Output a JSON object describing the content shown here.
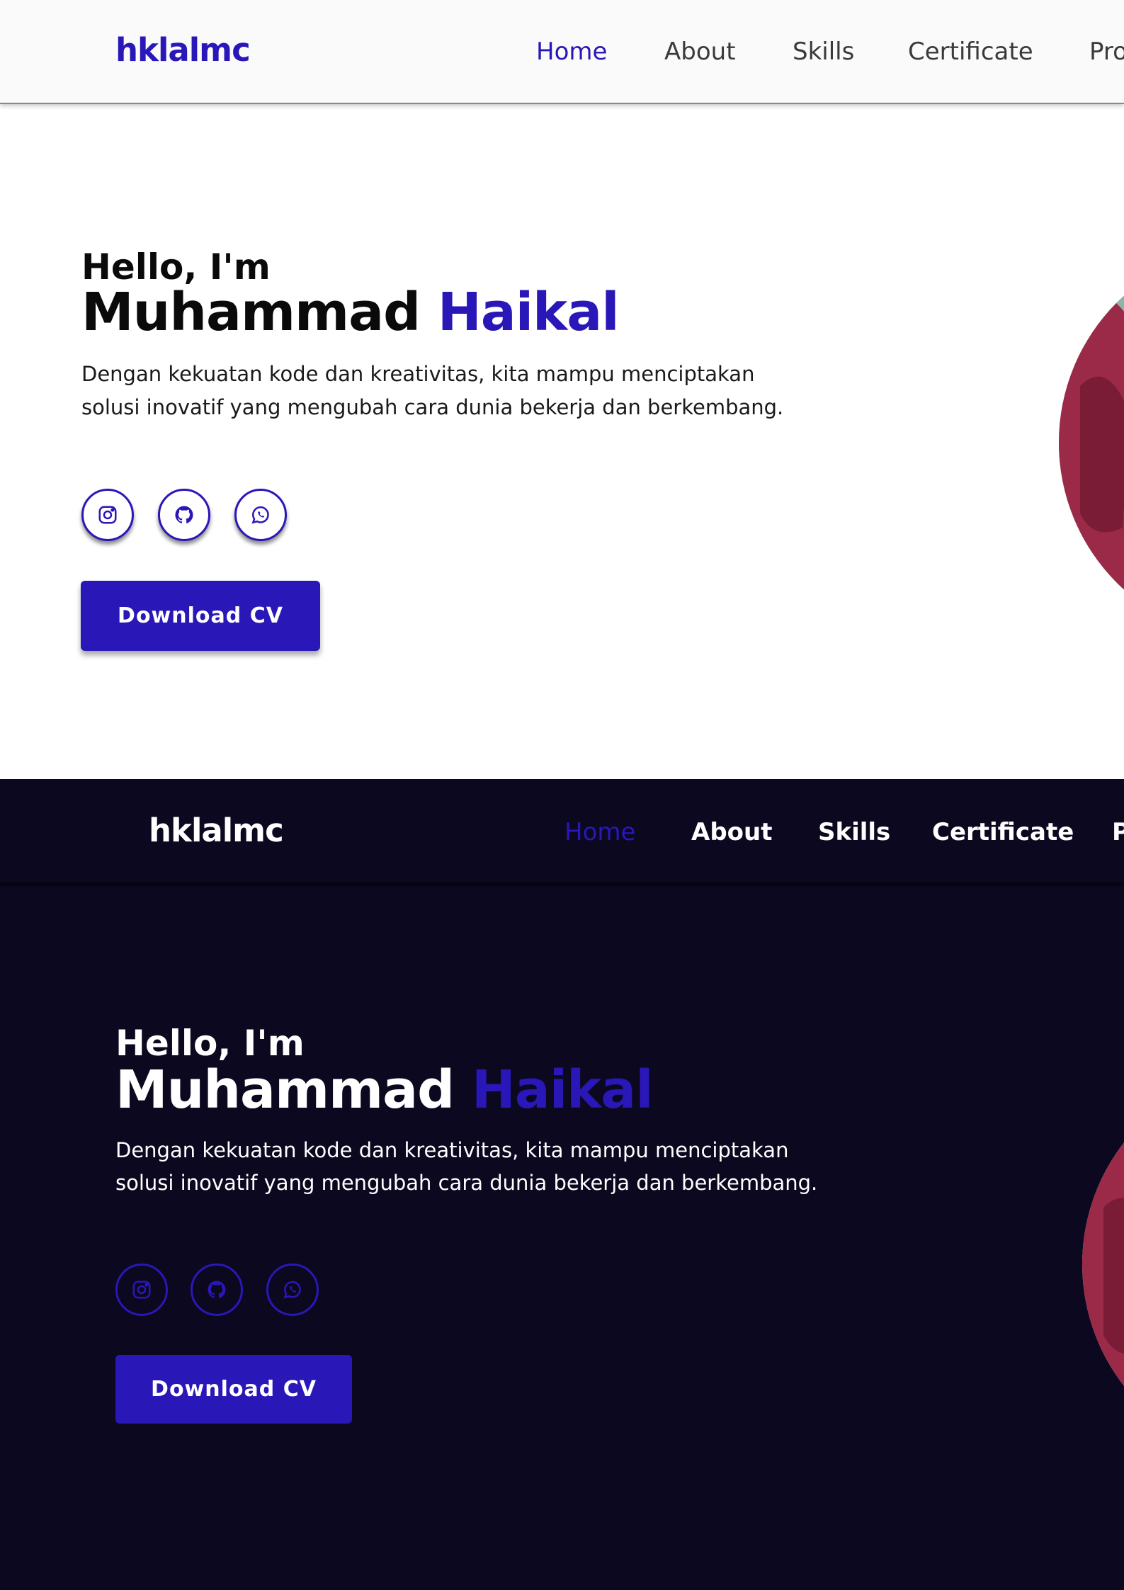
{
  "light": {
    "logo": "hklalmc",
    "nav": [
      {
        "label": "Home",
        "active": true
      },
      {
        "label": "About"
      },
      {
        "label": "Skills"
      },
      {
        "label": "Certificate"
      },
      {
        "label": "Pro"
      }
    ],
    "hero": {
      "greeting": "Hello, I'm",
      "first_name": "Muhammad",
      "last_name": "Haikal",
      "description": "Dengan kekuatan kode dan kreativitas, kita mampu menciptakan solusi inovatif yang mengubah cara dunia bekerja dan berkembang.",
      "social_icons": [
        "instagram-icon",
        "github-icon",
        "whatsapp-icon"
      ],
      "button_label": "Download CV"
    }
  },
  "dark": {
    "logo": "hklalmc",
    "nav": [
      {
        "label": "Home",
        "active": true
      },
      {
        "label": "About"
      },
      {
        "label": "Skills"
      },
      {
        "label": "Certificate"
      },
      {
        "label": "P"
      }
    ],
    "hero": {
      "greeting": "Hello, I'm",
      "first_name": "Muhammad",
      "last_name": "Haikal",
      "description": "Dengan kekuatan kode dan kreativitas, kita mampu menciptakan solusi inovatif yang mengubah cara dunia bekerja dan berkembang.",
      "social_icons": [
        "instagram-icon",
        "github-icon",
        "whatsapp-icon"
      ],
      "button_label": "Download CV"
    }
  },
  "colors": {
    "accent": "#2a17b8",
    "dark_bg": "#0b0820",
    "light_nav_bg": "#fafafa"
  }
}
